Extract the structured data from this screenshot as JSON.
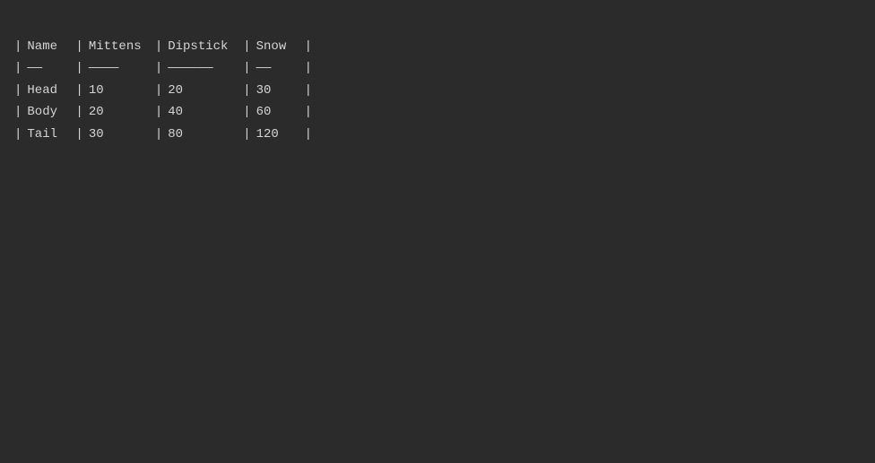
{
  "table": {
    "headers": [
      "Name",
      "Mittens",
      "Dipstick",
      "Snow"
    ],
    "separators": [
      "——",
      "————",
      "——————",
      "——"
    ],
    "rows": [
      [
        "Head",
        "10",
        "20",
        "30"
      ],
      [
        "Body",
        "20",
        "40",
        "60"
      ],
      [
        "Tail",
        "30",
        "80",
        "120"
      ]
    ]
  }
}
